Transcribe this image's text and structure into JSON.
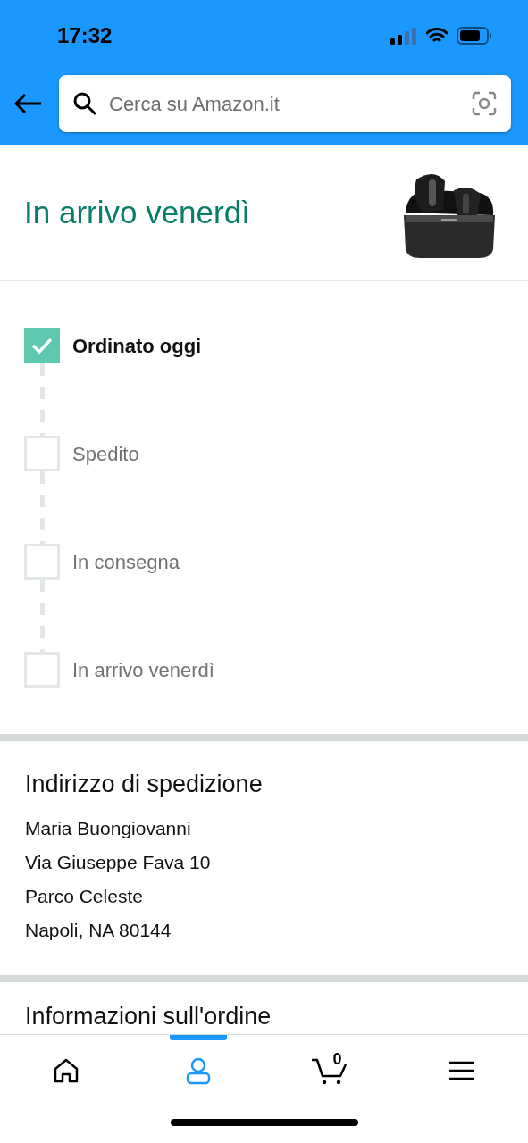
{
  "status_bar": {
    "time": "17:32"
  },
  "search": {
    "placeholder": "Cerca su Amazon.it"
  },
  "header": {
    "title": "In arrivo venerdì"
  },
  "steps": [
    {
      "label": "Ordinato oggi",
      "checked": true
    },
    {
      "label": "Spedito",
      "checked": false
    },
    {
      "label": "In consegna",
      "checked": false
    },
    {
      "label": "In arrivo venerdì",
      "checked": false
    }
  ],
  "address": {
    "title": "Indirizzo di spedizione",
    "lines": [
      "Maria Buongiovanni",
      "Via Giuseppe Fava 10",
      "Parco Celeste",
      "Napoli, NA 80144"
    ]
  },
  "order_info": {
    "title": "Informazioni sull'ordine"
  },
  "bottom_nav": [
    {
      "kind": "home",
      "selected": false
    },
    {
      "kind": "account",
      "selected": true
    },
    {
      "kind": "cart",
      "selected": false,
      "count": "0"
    },
    {
      "kind": "menu",
      "selected": false
    }
  ]
}
